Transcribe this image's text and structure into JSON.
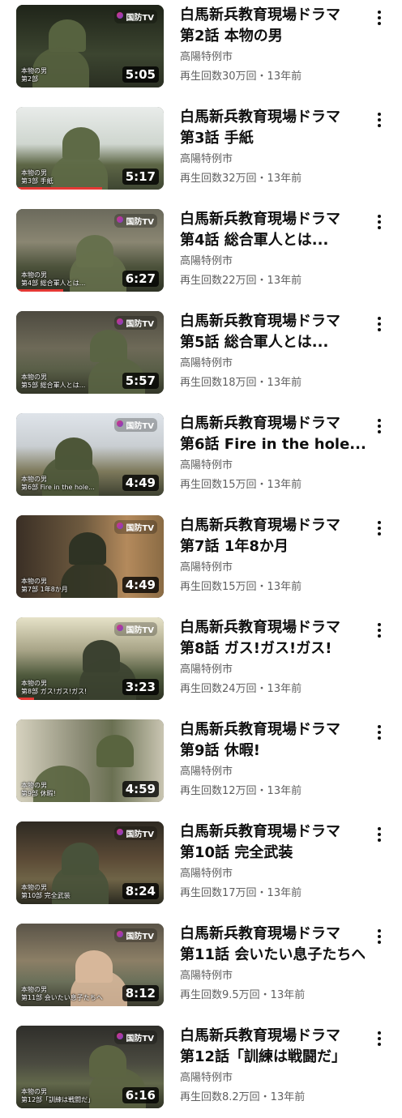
{
  "channel": "高陽特例市",
  "videos": [
    {
      "title_line1": "白馬新兵教育現場ドラマ",
      "title_line2": "第2話 本物の男",
      "channel": "高陽特例市",
      "meta": "再生回数30万回・13年前",
      "duration": "5:05",
      "logo": "国防TV",
      "caption_line1": "本物の男",
      "caption_line2": "第2部",
      "watched_fraction": 0.0
    },
    {
      "title_line1": "白馬新兵教育現場ドラマ",
      "title_line2": "第3話 手紙",
      "channel": "高陽特例市",
      "meta": "再生回数32万回・13年前",
      "duration": "5:17",
      "logo": "",
      "caption_line1": "本物の男",
      "caption_line2": "第3部 手紙",
      "watched_fraction": 0.58
    },
    {
      "title_line1": "白馬新兵教育現場ドラマ",
      "title_line2": "第4話 総合軍人とは...",
      "channel": "高陽特例市",
      "meta": "再生回数22万回・13年前",
      "duration": "6:27",
      "logo": "国防TV",
      "caption_line1": "本物の男",
      "caption_line2": "第4部 総合軍人とは...",
      "watched_fraction": 0.32
    },
    {
      "title_line1": "白馬新兵教育現場ドラマ",
      "title_line2": "第5話 総合軍人とは...",
      "channel": "高陽特例市",
      "meta": "再生回数18万回・13年前",
      "duration": "5:57",
      "logo": "国防TV",
      "caption_line1": "本物の男",
      "caption_line2": "第5部 総合軍人とは...",
      "watched_fraction": 0.0
    },
    {
      "title_line1": "白馬新兵教育現場ドラマ",
      "title_line2": "第6話 Fire in the hole...",
      "channel": "高陽特例市",
      "meta": "再生回数15万回・13年前",
      "duration": "4:49",
      "logo": "国防TV",
      "caption_line1": "本物の男",
      "caption_line2": "第6部 Fire in the hole...",
      "watched_fraction": 0.0
    },
    {
      "title_line1": "白馬新兵教育現場ドラマ",
      "title_line2": "第7話 1年8か月",
      "channel": "高陽特例市",
      "meta": "再生回数15万回・13年前",
      "duration": "4:49",
      "logo": "国防TV",
      "caption_line1": "本物の男",
      "caption_line2": "第7部 1年8か月",
      "watched_fraction": 0.0
    },
    {
      "title_line1": "白馬新兵教育現場ドラマ",
      "title_line2": "第8話 ガス!ガス!ガス!",
      "channel": "高陽特例市",
      "meta": "再生回数24万回・13年前",
      "duration": "3:23",
      "logo": "国防TV",
      "caption_line1": "本物の男",
      "caption_line2": "第8部 ガス!ガス!ガス!",
      "watched_fraction": 0.12
    },
    {
      "title_line1": "白馬新兵教育現場ドラマ",
      "title_line2": "第9話 休暇!",
      "channel": "高陽特例市",
      "meta": "再生回数12万回・13年前",
      "duration": "4:59",
      "logo": "",
      "caption_line1": "本物の男",
      "caption_line2": "第9部 休暇!",
      "watched_fraction": 0.0
    },
    {
      "title_line1": "白馬新兵教育現場ドラマ",
      "title_line2": "第10話 完全武装",
      "channel": "高陽特例市",
      "meta": "再生回数17万回・13年前",
      "duration": "8:24",
      "logo": "国防TV",
      "caption_line1": "本物の男",
      "caption_line2": "第10部 完全武装",
      "watched_fraction": 0.0
    },
    {
      "title_line1": "白馬新兵教育現場ドラマ",
      "title_line2": "第11話 会いたい息子たちへ",
      "channel": "高陽特例市",
      "meta": "再生回数9.5万回・13年前",
      "duration": "8:12",
      "logo": "国防TV",
      "caption_line1": "本物の男",
      "caption_line2": "第11部 会いたい息子たちへ",
      "watched_fraction": 0.0
    },
    {
      "title_line1": "白馬新兵教育現場ドラマ",
      "title_line2": "第12話「訓練は戦闘だ」",
      "channel": "高陽特例市",
      "meta": "再生回数8.2万回・13年前",
      "duration": "6:16",
      "logo": "国防TV",
      "caption_line1": "本物の男",
      "caption_line2": "第12部「訓練は戦闘だ」",
      "watched_fraction": 0.0
    }
  ]
}
